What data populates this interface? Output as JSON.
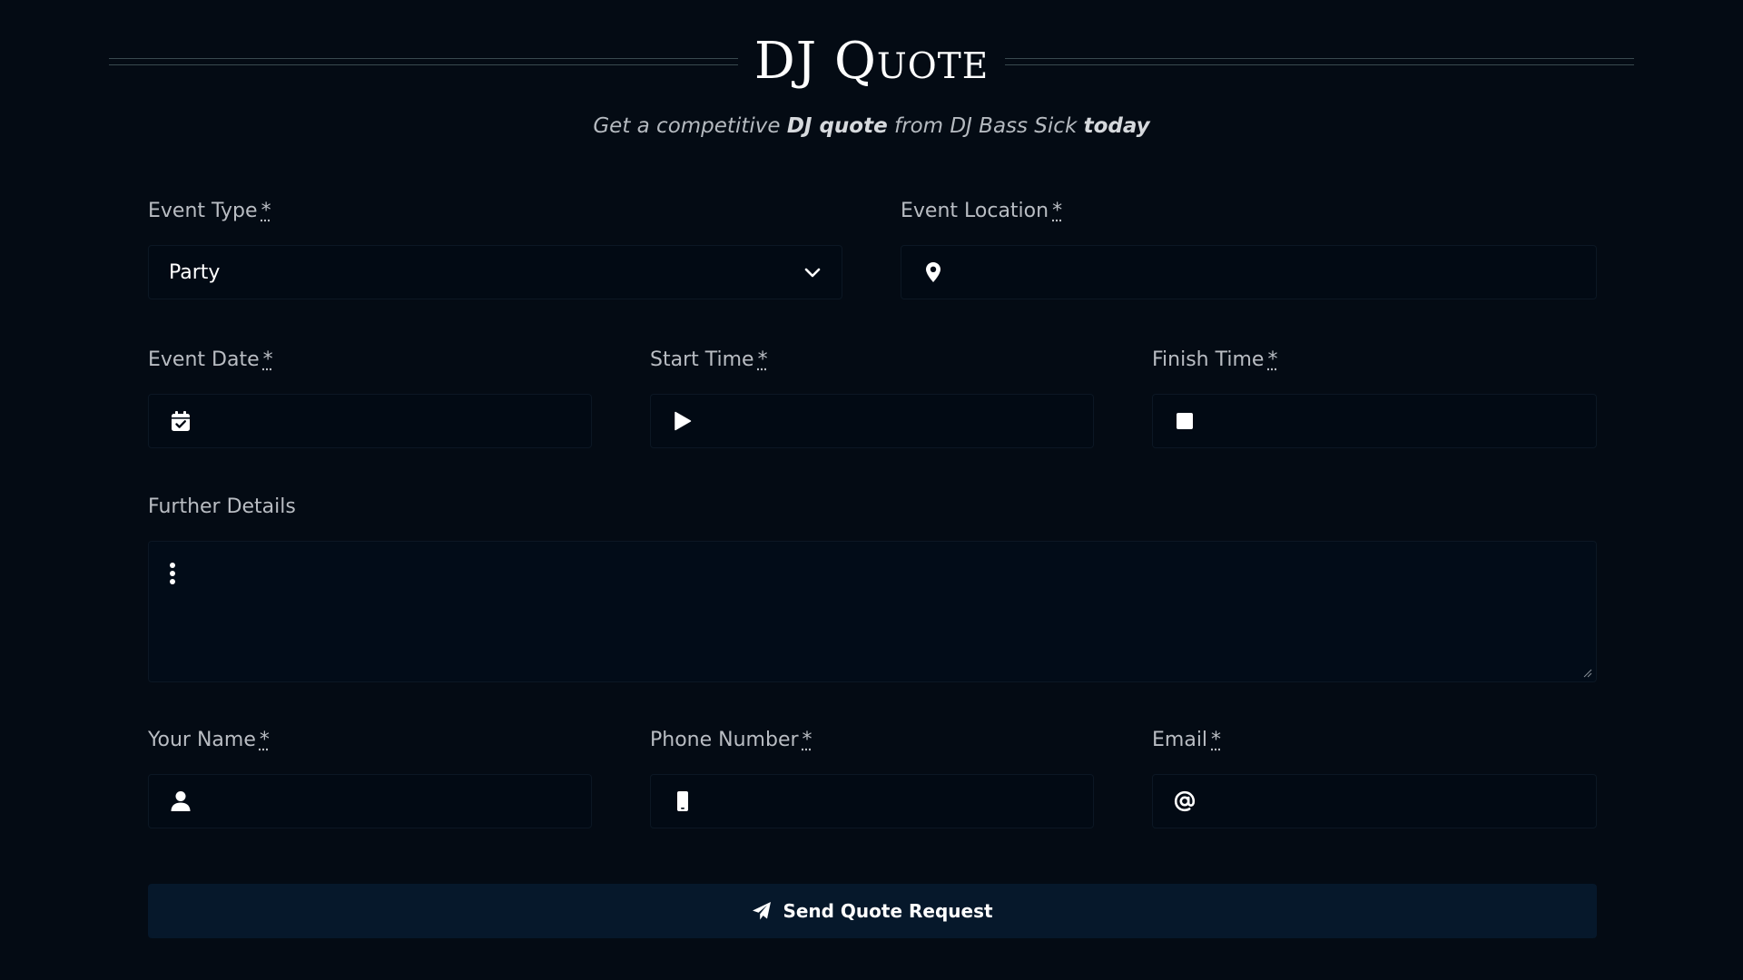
{
  "header": {
    "title": "DJ Quote",
    "subtitle": {
      "part1": "Get a competitive ",
      "bold1": "DJ quote",
      "part2": " from DJ Bass Sick ",
      "bold2": "today"
    }
  },
  "form": {
    "required_marker": "*",
    "event_type": {
      "label": "Event Type",
      "value": "Party",
      "icon": "chevron-down-icon"
    },
    "event_location": {
      "label": "Event Location",
      "value": "",
      "icon": "map-marker-icon"
    },
    "event_date": {
      "label": "Event Date",
      "value": "",
      "icon": "calendar-check-icon"
    },
    "start_time": {
      "label": "Start Time",
      "value": "",
      "icon": "play-icon"
    },
    "finish_time": {
      "label": "Finish Time",
      "value": "",
      "icon": "stop-icon"
    },
    "further_details": {
      "label": "Further Details",
      "value": "",
      "icon": "ellipsis-vertical-icon"
    },
    "your_name": {
      "label": "Your Name",
      "value": "",
      "icon": "user-icon"
    },
    "phone_number": {
      "label": "Phone Number",
      "value": "",
      "icon": "mobile-phone-icon"
    },
    "email": {
      "label": "Email",
      "value": "",
      "icon": "at-sign-icon"
    },
    "submit_label": "Send Quote Request",
    "submit_icon": "paper-plane-icon"
  },
  "colors": {
    "background": "#040b14",
    "field_background": "#020a14",
    "button_background": "#06182b",
    "text": "#c9cdd3",
    "title": "#ffffff"
  }
}
